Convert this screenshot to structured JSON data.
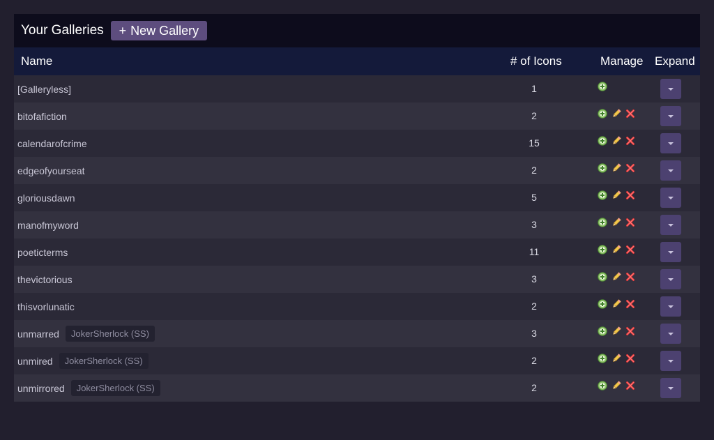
{
  "header": {
    "title": "Your Galleries",
    "new_gallery_plus": "+",
    "new_gallery_label": "New Gallery"
  },
  "table": {
    "columns": {
      "name": "Name",
      "count": "# of Icons",
      "manage": "Manage",
      "expand": "Expand"
    },
    "rows": [
      {
        "name": "[Galleryless]",
        "count": "1",
        "badge": null,
        "editable": false
      },
      {
        "name": "bitofafiction",
        "count": "2",
        "badge": null,
        "editable": true
      },
      {
        "name": "calendarofcrime",
        "count": "15",
        "badge": null,
        "editable": true
      },
      {
        "name": "edgeofyourseat",
        "count": "2",
        "badge": null,
        "editable": true
      },
      {
        "name": "gloriousdawn",
        "count": "5",
        "badge": null,
        "editable": true
      },
      {
        "name": "manofmyword",
        "count": "3",
        "badge": null,
        "editable": true
      },
      {
        "name": "poeticterms",
        "count": "11",
        "badge": null,
        "editable": true
      },
      {
        "name": "thevictorious",
        "count": "3",
        "badge": null,
        "editable": true
      },
      {
        "name": "thisvorlunatic",
        "count": "2",
        "badge": null,
        "editable": true
      },
      {
        "name": "unmarred",
        "count": "3",
        "badge": "JokerSherlock (SS)",
        "editable": true
      },
      {
        "name": "unmired",
        "count": "2",
        "badge": "JokerSherlock (SS)",
        "editable": true
      },
      {
        "name": "unmirrored",
        "count": "2",
        "badge": "JokerSherlock (SS)",
        "editable": true
      }
    ]
  },
  "icons": {
    "add": "add-icon",
    "edit": "pencil-icon",
    "delete": "delete-icon",
    "expand": "chevron-down-icon"
  },
  "colors": {
    "page_bg": "#221f2e",
    "title_bar_bg": "#0d0c1c",
    "header_bg": "#141a3a",
    "row_odd": "#2b2937",
    "row_even": "#33313f",
    "accent": "#5d4d7e",
    "expand_button": "#4c4170"
  }
}
